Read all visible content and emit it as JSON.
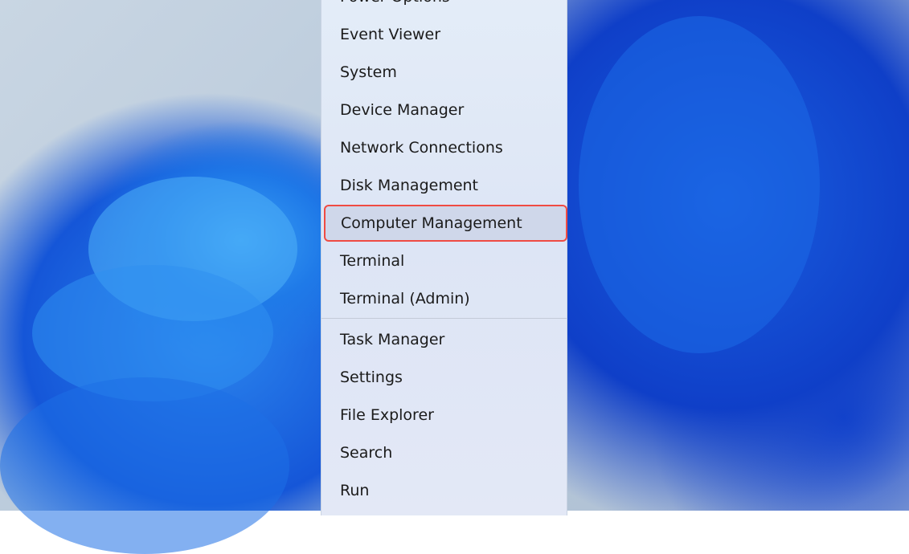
{
  "menu": {
    "group1": [
      "Power Options",
      "Event Viewer",
      "System",
      "Device Manager",
      "Network Connections",
      "Disk Management",
      "Computer Management",
      "Terminal",
      "Terminal (Admin)"
    ],
    "group2": [
      "Task Manager",
      "Settings",
      "File Explorer",
      "Search",
      "Run"
    ],
    "highlighted": "Computer Management",
    "highlight_color": "#ef4b43"
  }
}
